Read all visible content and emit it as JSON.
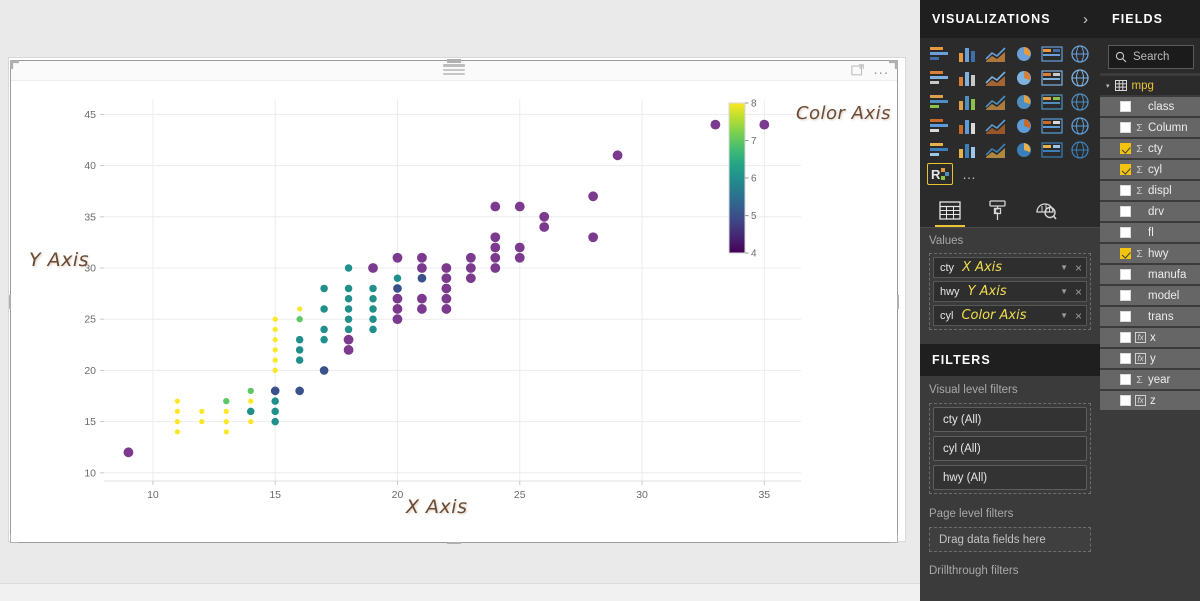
{
  "chart_data": {
    "type": "scatter",
    "title": "",
    "xlabel": "X Axis",
    "ylabel": "Y Axis",
    "x_field": "cty",
    "y_field": "hwy",
    "color_field": "cyl",
    "xlim": [
      8,
      36.5
    ],
    "ylim": [
      9.2,
      46.5
    ],
    "xticks": [
      10,
      15,
      20,
      25,
      30,
      35
    ],
    "yticks": [
      10,
      15,
      20,
      25,
      30,
      35,
      40,
      45
    ],
    "grid": true,
    "colormap": "viridis",
    "colorbar": {
      "label": "Color Axis",
      "min": 4,
      "max": 8,
      "ticks": [
        4,
        5,
        6,
        7,
        8
      ],
      "stops": [
        "#440154",
        "#3b528b",
        "#21918c",
        "#5ec962",
        "#fde725"
      ]
    },
    "points": [
      {
        "x": 9,
        "y": 12,
        "c": 8
      },
      {
        "x": 11,
        "y": 17,
        "c": 4
      },
      {
        "x": 11,
        "y": 16,
        "c": 4
      },
      {
        "x": 11,
        "y": 15,
        "c": 4
      },
      {
        "x": 11,
        "y": 14,
        "c": 4
      },
      {
        "x": 12,
        "y": 16,
        "c": 4
      },
      {
        "x": 12,
        "y": 15,
        "c": 4
      },
      {
        "x": 13,
        "y": 17,
        "c": 5
      },
      {
        "x": 13,
        "y": 16,
        "c": 4
      },
      {
        "x": 13,
        "y": 15,
        "c": 4
      },
      {
        "x": 13,
        "y": 14,
        "c": 4
      },
      {
        "x": 14,
        "y": 18,
        "c": 5
      },
      {
        "x": 14,
        "y": 17,
        "c": 4
      },
      {
        "x": 14,
        "y": 16,
        "c": 6
      },
      {
        "x": 14,
        "y": 15,
        "c": 4
      },
      {
        "x": 15,
        "y": 25,
        "c": 4
      },
      {
        "x": 15,
        "y": 24,
        "c": 4
      },
      {
        "x": 15,
        "y": 23,
        "c": 4
      },
      {
        "x": 15,
        "y": 22,
        "c": 4
      },
      {
        "x": 15,
        "y": 21,
        "c": 4
      },
      {
        "x": 15,
        "y": 20,
        "c": 4
      },
      {
        "x": 15,
        "y": 18,
        "c": 7
      },
      {
        "x": 15,
        "y": 17,
        "c": 6
      },
      {
        "x": 15,
        "y": 16,
        "c": 6
      },
      {
        "x": 15,
        "y": 15,
        "c": 6
      },
      {
        "x": 16,
        "y": 26,
        "c": 4
      },
      {
        "x": 16,
        "y": 25,
        "c": 5
      },
      {
        "x": 16,
        "y": 23,
        "c": 6
      },
      {
        "x": 16,
        "y": 22,
        "c": 6
      },
      {
        "x": 16,
        "y": 21,
        "c": 6
      },
      {
        "x": 16,
        "y": 18,
        "c": 7
      },
      {
        "x": 17,
        "y": 28,
        "c": 6
      },
      {
        "x": 17,
        "y": 26,
        "c": 6
      },
      {
        "x": 17,
        "y": 24,
        "c": 6
      },
      {
        "x": 17,
        "y": 23,
        "c": 6
      },
      {
        "x": 17,
        "y": 20,
        "c": 7
      },
      {
        "x": 18,
        "y": 30,
        "c": 6
      },
      {
        "x": 18,
        "y": 28,
        "c": 6
      },
      {
        "x": 18,
        "y": 27,
        "c": 6
      },
      {
        "x": 18,
        "y": 26,
        "c": 6
      },
      {
        "x": 18,
        "y": 25,
        "c": 6
      },
      {
        "x": 18,
        "y": 24,
        "c": 6
      },
      {
        "x": 18,
        "y": 23,
        "c": 8
      },
      {
        "x": 18,
        "y": 22,
        "c": 8
      },
      {
        "x": 19,
        "y": 30,
        "c": 8
      },
      {
        "x": 19,
        "y": 28,
        "c": 6
      },
      {
        "x": 19,
        "y": 27,
        "c": 6
      },
      {
        "x": 19,
        "y": 26,
        "c": 6
      },
      {
        "x": 19,
        "y": 25,
        "c": 6
      },
      {
        "x": 19,
        "y": 24,
        "c": 6
      },
      {
        "x": 20,
        "y": 31,
        "c": 8
      },
      {
        "x": 20,
        "y": 29,
        "c": 6
      },
      {
        "x": 20,
        "y": 28,
        "c": 7
      },
      {
        "x": 20,
        "y": 27,
        "c": 8
      },
      {
        "x": 20,
        "y": 26,
        "c": 8
      },
      {
        "x": 20,
        "y": 25,
        "c": 8
      },
      {
        "x": 21,
        "y": 31,
        "c": 8
      },
      {
        "x": 21,
        "y": 30,
        "c": 8
      },
      {
        "x": 21,
        "y": 29,
        "c": 7
      },
      {
        "x": 21,
        "y": 27,
        "c": 8
      },
      {
        "x": 21,
        "y": 26,
        "c": 8
      },
      {
        "x": 22,
        "y": 30,
        "c": 8
      },
      {
        "x": 22,
        "y": 29,
        "c": 8
      },
      {
        "x": 22,
        "y": 28,
        "c": 8
      },
      {
        "x": 22,
        "y": 27,
        "c": 8
      },
      {
        "x": 22,
        "y": 26,
        "c": 8
      },
      {
        "x": 23,
        "y": 31,
        "c": 8
      },
      {
        "x": 23,
        "y": 30,
        "c": 8
      },
      {
        "x": 23,
        "y": 29,
        "c": 8
      },
      {
        "x": 24,
        "y": 36,
        "c": 8
      },
      {
        "x": 24,
        "y": 33,
        "c": 8
      },
      {
        "x": 24,
        "y": 32,
        "c": 8
      },
      {
        "x": 24,
        "y": 31,
        "c": 8
      },
      {
        "x": 24,
        "y": 30,
        "c": 8
      },
      {
        "x": 25,
        "y": 36,
        "c": 8
      },
      {
        "x": 25,
        "y": 32,
        "c": 8
      },
      {
        "x": 25,
        "y": 31,
        "c": 8
      },
      {
        "x": 26,
        "y": 35,
        "c": 8
      },
      {
        "x": 26,
        "y": 34,
        "c": 8
      },
      {
        "x": 28,
        "y": 37,
        "c": 8
      },
      {
        "x": 28,
        "y": 33,
        "c": 8
      },
      {
        "x": 29,
        "y": 41,
        "c": 8
      },
      {
        "x": 33,
        "y": 44,
        "c": 8
      },
      {
        "x": 35,
        "y": 44,
        "c": 8
      }
    ]
  },
  "visual": {
    "header": {
      "drag_handle": "drag-handle-icon",
      "focus_mode": "focus-mode-icon",
      "more_options": "..."
    },
    "annotations": {
      "color_axis": "Color Axis",
      "y_axis": "Y Axis",
      "x_axis": "X Axis"
    }
  },
  "visualizations": {
    "title": "VISUALIZATIONS",
    "expand_chevron": "›",
    "gallery_more": "…",
    "tabs": [
      {
        "name": "fields-tab",
        "label": "Fields"
      },
      {
        "name": "format-tab",
        "label": "Format"
      },
      {
        "name": "analytics-tab",
        "label": "Analytics"
      }
    ],
    "wells_label": "Values",
    "wells": [
      {
        "field": "cty",
        "annotation": "X Axis",
        "caret": "▼",
        "remove": "×"
      },
      {
        "field": "hwy",
        "annotation": "Y Axis",
        "caret": "▼",
        "remove": "×"
      },
      {
        "field": "cyl",
        "annotation": "Color Axis",
        "caret": "▼",
        "remove": "×"
      }
    ]
  },
  "filters": {
    "title": "FILTERS",
    "visual_level_label": "Visual level filters",
    "visual_level_items": [
      "cty  (All)",
      "cyl  (All)",
      "hwy  (All)"
    ],
    "page_level_label": "Page level filters",
    "page_level_drop": "Drag data fields here",
    "drillthrough_label": "Drillthrough filters"
  },
  "fields": {
    "title": "FIELDS",
    "search_placeholder": "Search",
    "table": {
      "name": "mpg",
      "caret": "▾"
    },
    "items": [
      {
        "label": "class",
        "checked": false,
        "type": "text"
      },
      {
        "label": "Column",
        "checked": false,
        "type": "sum"
      },
      {
        "label": "cty",
        "checked": true,
        "type": "sum"
      },
      {
        "label": "cyl",
        "checked": true,
        "type": "sum"
      },
      {
        "label": "displ",
        "checked": false,
        "type": "sum"
      },
      {
        "label": "drv",
        "checked": false,
        "type": "text"
      },
      {
        "label": "fl",
        "checked": false,
        "type": "text"
      },
      {
        "label": "hwy",
        "checked": true,
        "type": "sum"
      },
      {
        "label": "manufa",
        "checked": false,
        "type": "text"
      },
      {
        "label": "model",
        "checked": false,
        "type": "text"
      },
      {
        "label": "trans",
        "checked": false,
        "type": "text"
      },
      {
        "label": "x",
        "checked": false,
        "type": "fx"
      },
      {
        "label": "y",
        "checked": false,
        "type": "fx"
      },
      {
        "label": "year",
        "checked": false,
        "type": "sum"
      },
      {
        "label": "z",
        "checked": false,
        "type": "fx"
      }
    ]
  }
}
